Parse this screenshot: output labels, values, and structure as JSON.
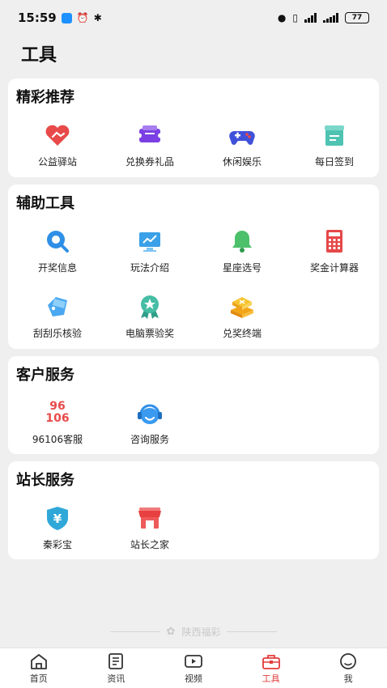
{
  "status_bar": {
    "time": "15:59",
    "battery": "77"
  },
  "page_title": "工具",
  "sections": [
    {
      "title": "精彩推荐",
      "items": [
        {
          "label": "公益驿站",
          "icon": "heart-hands-icon"
        },
        {
          "label": "兑换券礼品",
          "icon": "coupon-icon"
        },
        {
          "label": "休闲娱乐",
          "icon": "gamepad-icon"
        },
        {
          "label": "每日签到",
          "icon": "calendar-check-icon"
        }
      ]
    },
    {
      "title": "辅助工具",
      "items": [
        {
          "label": "开奖信息",
          "icon": "search-info-icon"
        },
        {
          "label": "玩法介绍",
          "icon": "monitor-chart-icon"
        },
        {
          "label": "星座选号",
          "icon": "bell-icon"
        },
        {
          "label": "奖金计算器",
          "icon": "calculator-icon"
        },
        {
          "label": "刮刮乐核验",
          "icon": "tag-icon"
        },
        {
          "label": "电脑票验奖",
          "icon": "award-ribbon-icon"
        },
        {
          "label": "兑奖终端",
          "icon": "stacked-boxes-icon"
        }
      ]
    },
    {
      "title": "客户服务",
      "items": [
        {
          "label": "96106客服",
          "icon": "hotline-icon",
          "badge_top": "96",
          "badge_bottom": "106"
        },
        {
          "label": "咨询服务",
          "icon": "headset-icon"
        }
      ]
    },
    {
      "title": "站长服务",
      "items": [
        {
          "label": "秦彩宝",
          "icon": "yen-shield-icon"
        },
        {
          "label": "站长之家",
          "icon": "storefront-icon"
        }
      ]
    }
  ],
  "footer_mark": "陕西福彩",
  "tabbar": [
    {
      "label": "首页",
      "icon": "home-icon"
    },
    {
      "label": "资讯",
      "icon": "news-icon"
    },
    {
      "label": "视频",
      "icon": "video-icon"
    },
    {
      "label": "工具",
      "icon": "toolbox-icon",
      "active": true
    },
    {
      "label": "我",
      "icon": "profile-icon"
    }
  ],
  "colors": {
    "accent": "#e23c3c",
    "card_bg": "#ffffff",
    "page_bg": "#efefef"
  }
}
